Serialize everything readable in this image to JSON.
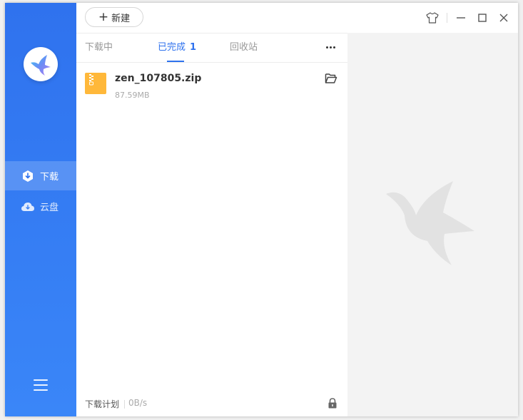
{
  "toolbar": {
    "new_label": "新建",
    "new_icon": "plus-icon",
    "controls": [
      "skin-icon",
      "minimize-icon",
      "maximize-icon",
      "close-icon"
    ]
  },
  "sidebar": {
    "logo_icon": "hummingbird-logo-icon",
    "items": [
      {
        "label": "下载",
        "icon": "download-icon",
        "active": true
      },
      {
        "label": "云盘",
        "icon": "cloud-icon",
        "active": false
      }
    ],
    "menu_icon": "hamburger-menu-icon"
  },
  "tabs": [
    {
      "label": "下载中"
    },
    {
      "label": "已完成",
      "count": "1",
      "active": true
    },
    {
      "label": "回收站"
    }
  ],
  "more_icon": "more-dots-icon",
  "files": [
    {
      "name": "zen_107805.zip",
      "size": "87.59MB",
      "icon": "zip-file-icon",
      "action_icon": "open-folder-icon"
    }
  ],
  "footer": {
    "plan_label": "下载计划",
    "speed": "0B/s",
    "lock_icon": "lock-icon"
  },
  "colors": {
    "brand": "#2f72ee",
    "sidebar_bottom": "#3a86f8",
    "zip": "#ffb83a",
    "detail_bg": "#f3f3f3"
  }
}
